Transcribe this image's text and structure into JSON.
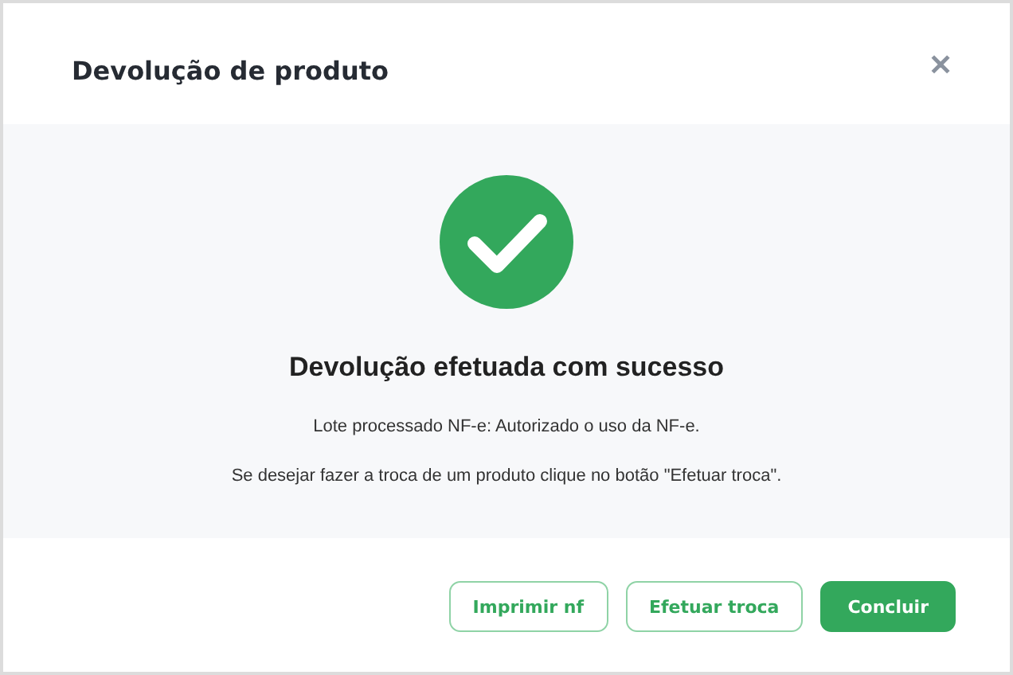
{
  "dialog": {
    "title": "Devolução de produto",
    "close": "✕"
  },
  "message": {
    "heading": "Devolução efetuada com sucesso",
    "lines": [
      "Lote processado NF-e: Autorizado o uso da NF-e.",
      "Se desejar fazer a troca de um produto clique no botão \"Efetuar troca\"."
    ]
  },
  "buttons": [
    {
      "label": "Imprimir nf",
      "kind": "outline"
    },
    {
      "label": "Efetuar troca",
      "kind": "outline"
    },
    {
      "label": "Concluir",
      "kind": "primary"
    }
  ]
}
